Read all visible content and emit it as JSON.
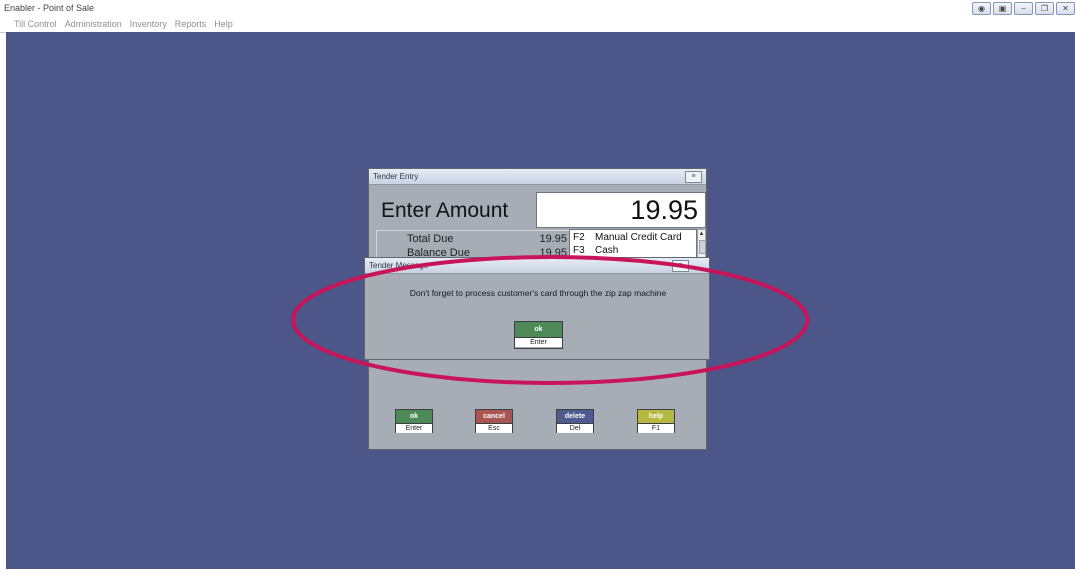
{
  "window": {
    "title": "Enabler - Point of Sale",
    "controls": [
      "◉",
      "▣",
      "–",
      "❐",
      "✕"
    ]
  },
  "menubar": {
    "items": [
      "Till Control",
      "Administration",
      "Inventory",
      "Reports",
      "Help"
    ]
  },
  "tender_entry": {
    "title": "Tender Entry",
    "menu_icon": "≡",
    "enter_label": "Enter Amount",
    "amount": "19.95",
    "totals": [
      {
        "label": "Total Due",
        "value": "19.95"
      },
      {
        "label": "Balance Due",
        "value": "19.95"
      }
    ],
    "tender_types": [
      {
        "key": "F2",
        "name": "Manual Credit Card"
      },
      {
        "key": "F3",
        "name": "Cash"
      }
    ],
    "buttons": [
      {
        "top": "ok",
        "bottom": "Enter"
      },
      {
        "top": "cancel",
        "bottom": "Esc"
      },
      {
        "top": "delete",
        "bottom": "Del"
      },
      {
        "top": "help",
        "bottom": "F1"
      }
    ]
  },
  "tender_message": {
    "title": "Tender Message",
    "menu_icon": "≡",
    "message": "Don't forget to process customer's card through the zip zap machine",
    "ok_button": {
      "top": "ok",
      "bottom": "Enter"
    }
  },
  "colors": {
    "desktop": "#4c5688",
    "dialog": "#a6adb5",
    "highlight": "#c8155a",
    "ok": "#4e8a57",
    "cancel": "#a85553",
    "delete": "#4f5a90",
    "help": "#b7b83f"
  }
}
